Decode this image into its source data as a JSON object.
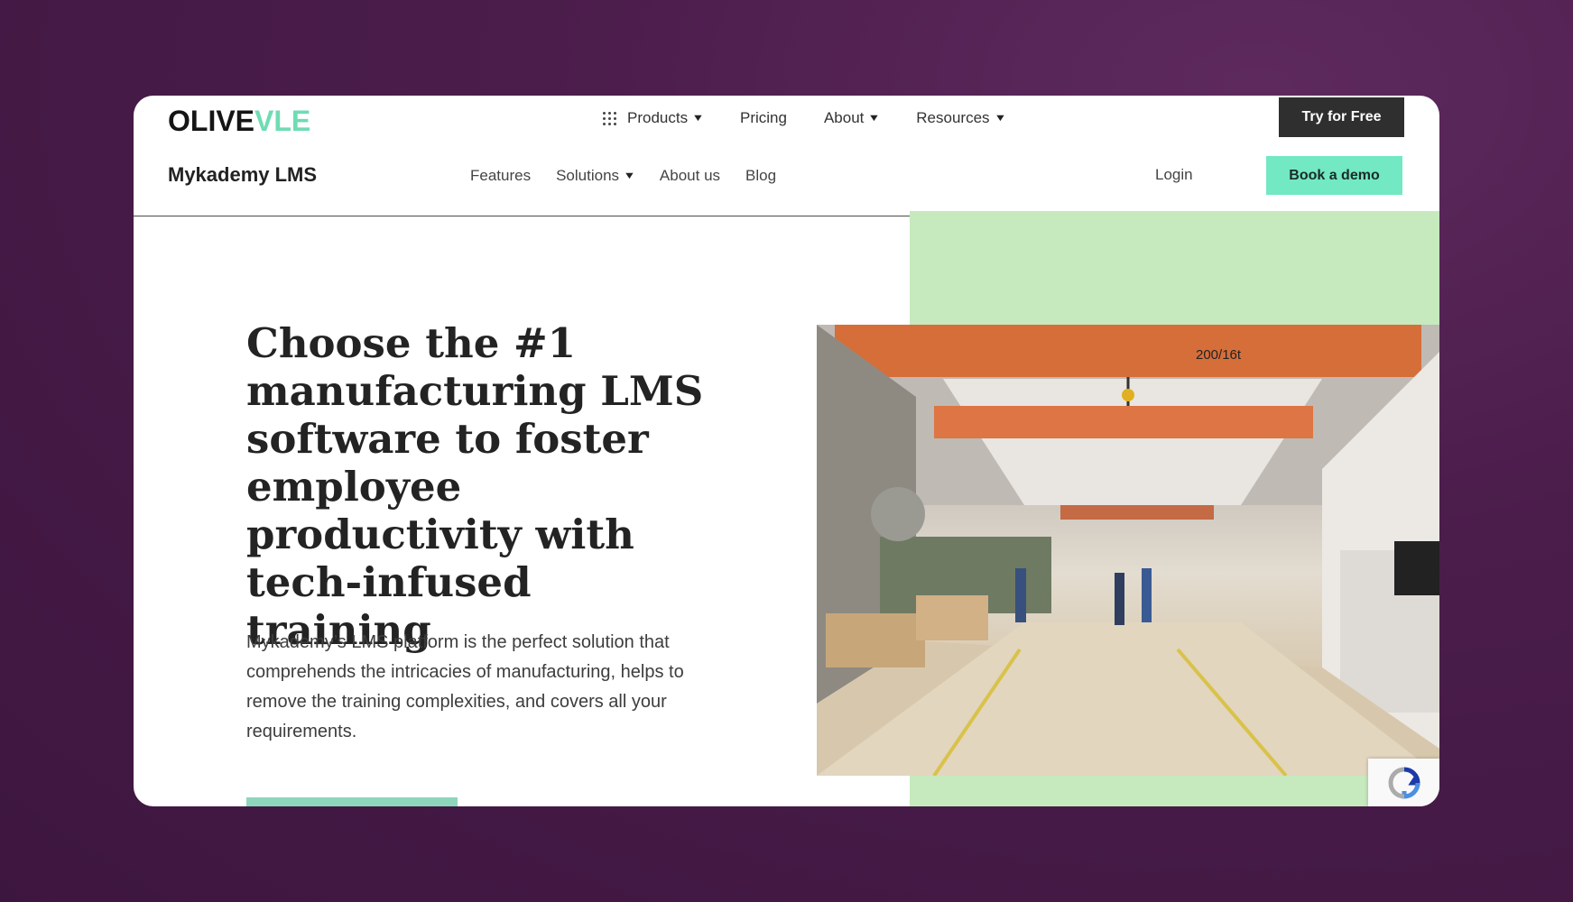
{
  "topnav": {
    "logo_part1": "OLIVE",
    "logo_part2": "VLE",
    "items": [
      {
        "label": "Products",
        "has_dropdown": true,
        "icon": "grid-icon"
      },
      {
        "label": "Pricing",
        "has_dropdown": false
      },
      {
        "label": "About",
        "has_dropdown": true
      },
      {
        "label": "Resources",
        "has_dropdown": true
      }
    ],
    "cta_label": "Try for Free"
  },
  "subnav": {
    "brand": "Mykademy LMS",
    "items": [
      {
        "label": "Features",
        "has_dropdown": false
      },
      {
        "label": "Solutions",
        "has_dropdown": true
      },
      {
        "label": "About us",
        "has_dropdown": false
      },
      {
        "label": "Blog",
        "has_dropdown": false
      }
    ],
    "login_label": "Login",
    "demo_label": "Book a demo"
  },
  "hero": {
    "headline_1": "Choose the ",
    "headline_2": "#1 manufacturing LMS software",
    "headline_3": " to foster employee productivity with tech-infused training",
    "description": "Mykademy’s LMS platform is the perfect solution that comprehends the intricacies of manufacturing, helps to remove the training complexities, and covers all your requirements.",
    "image_crane_label": "200/16t"
  },
  "colors": {
    "background": "#4b1d4b",
    "logo_accent": "#6fdcb3",
    "primary_button": "#2f2f2f",
    "demo_button": "#72e8c3",
    "panel_green": "#c6e9be"
  },
  "icons": {
    "chevron": "chevron-down-icon",
    "products": "grid-icon",
    "recaptcha": "recaptcha-icon"
  }
}
